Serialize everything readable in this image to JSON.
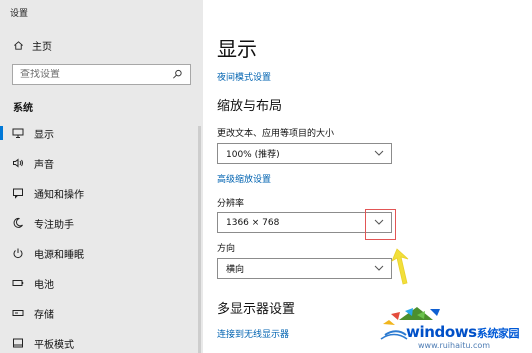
{
  "sidebar": {
    "app_title": "设置",
    "home_label": "主页",
    "search_placeholder": "查找设置",
    "section_title": "系统",
    "items": [
      {
        "label": "显示",
        "icon": "monitor-icon",
        "selected": true
      },
      {
        "label": "声音",
        "icon": "speaker-icon",
        "selected": false
      },
      {
        "label": "通知和操作",
        "icon": "message-icon",
        "selected": false
      },
      {
        "label": "专注助手",
        "icon": "moon-icon",
        "selected": false
      },
      {
        "label": "电源和睡眠",
        "icon": "power-icon",
        "selected": false
      },
      {
        "label": "电池",
        "icon": "battery-icon",
        "selected": false
      },
      {
        "label": "存储",
        "icon": "storage-icon",
        "selected": false
      },
      {
        "label": "平板模式",
        "icon": "tablet-icon",
        "selected": false
      }
    ]
  },
  "main": {
    "page_title": "显示",
    "night_mode_link": "夜间模式设置",
    "scale_layout_title": "缩放与布局",
    "scale_label": "更改文本、应用等项目的大小",
    "scale_value": "100% (推荐)",
    "advanced_scale_link": "高级缩放设置",
    "resolution_label": "分辨率",
    "resolution_value": "1366 × 768",
    "orientation_label": "方向",
    "orientation_value": "横向",
    "multi_display_title": "多显示器设置",
    "wireless_display_link": "连接到无线显示器"
  },
  "watermark": {
    "brand_text": "windows",
    "brand_cn": "系统家园",
    "site": "www.ruihaitu.com"
  },
  "colors": {
    "sidebar_bg": "#e9e9e9",
    "accent": "#0078d7",
    "link": "#0063b1",
    "highlight": "#e25555",
    "arrow": "#f2df3a"
  }
}
